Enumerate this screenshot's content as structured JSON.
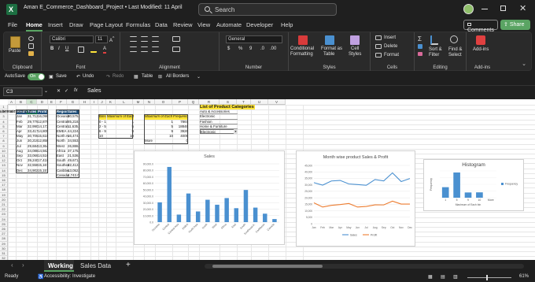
{
  "titlebar": {
    "file_title": "Aman E_Commerce_Dashboard_Project  •  Last Modified: 11 April",
    "search_placeholder": "Search"
  },
  "menu": {
    "tabs": [
      "File",
      "Home",
      "Insert",
      "Draw",
      "Page Layout",
      "Formulas",
      "Data",
      "Review",
      "View",
      "Automate",
      "Developer",
      "Help"
    ],
    "active": "Home",
    "comments_label": "Comments",
    "share_label": "Share"
  },
  "ribbon": {
    "paste": "Paste",
    "clipboard": "Clipboard",
    "font_name": "Calibri",
    "font_size": "11",
    "font": "Font",
    "alignment": "Alignment",
    "number_format": "General",
    "number": "Number",
    "conditional": "Conditional",
    "formatting": "Formatting",
    "format_as": "Format as",
    "table": "Table",
    "cell": "Cell",
    "styles_lbl": "Styles",
    "styles": "Styles",
    "insert": "Insert",
    "delete": "Delete",
    "format": "Format",
    "cells": "Cells",
    "sort_filter": "Sort &",
    "filter": "Filter",
    "find_select": "Find &",
    "select": "Select",
    "editing": "Editing",
    "addins": "Add-ins",
    "addins_group": "Add-ins"
  },
  "qat": {
    "autosave": "AutoSave",
    "toggle": "On",
    "save": "Save",
    "undo": "Undo",
    "redo": "Redo",
    "table": "Table",
    "all_borders": "All Borders"
  },
  "formula": {
    "name_box": "C3",
    "fx": "fx",
    "content": "Sales"
  },
  "columns": [
    "A",
    "B",
    "C",
    "D",
    "E",
    "F",
    "G",
    "H",
    "I",
    "J",
    "K",
    "L",
    "M",
    "N",
    "O",
    "P",
    "Q",
    "R",
    "S",
    "T",
    "U",
    "V"
  ],
  "rows": [
    "1",
    "2",
    "3",
    "4",
    "5",
    "6",
    "7",
    "8",
    "9",
    "10",
    "11",
    "12",
    "13",
    "14",
    "15",
    "16",
    "17",
    "18",
    "19",
    "20",
    "21",
    "22",
    "23",
    "24",
    "25",
    "26",
    "27",
    "28",
    "29",
    "30",
    "31",
    "32"
  ],
  "months_table": {
    "headers": [
      "Months",
      "Sales",
      "Profit"
    ],
    "rows": [
      [
        "Jan",
        "31,712",
        "16,090"
      ],
      [
        "Feb",
        "29,779",
        "12,879"
      ],
      [
        "Mar",
        "32,990",
        "14,173"
      ],
      [
        "Apr",
        "33,417",
        "14,805"
      ],
      [
        "May",
        "30,705",
        "15,618"
      ],
      [
        "Jun",
        "30,219",
        "12,858"
      ],
      [
        "Jul",
        "29,684",
        "13,364"
      ],
      [
        "Aug",
        "34,088",
        "14,562"
      ],
      [
        "Sep",
        "33,069",
        "14,516"
      ],
      [
        "Oct",
        "39,240",
        "17,418"
      ],
      [
        "Nov",
        "32,558",
        "15,167"
      ],
      [
        "Dec",
        "34,902",
        "15,157"
      ]
    ]
  },
  "regions_table": {
    "headers": [
      "Regions",
      "Sales"
    ],
    "rows": [
      [
        "Oceania",
        "30,575.8"
      ],
      [
        "Central",
        "85,218.0"
      ],
      [
        "Central Asia",
        "11,635.8"
      ],
      [
        "EMEA",
        "44,224.8"
      ],
      [
        "North Asia",
        "16,474.0"
      ],
      [
        "North",
        "34,553.0"
      ],
      [
        "West",
        "26,886.0"
      ],
      [
        "Africa",
        "37,175.0"
      ],
      [
        "East",
        "21,536.0"
      ],
      [
        "South",
        "49,671.0"
      ],
      [
        "Southeast A...",
        "22,412.0"
      ],
      [
        "Caribbean",
        "13,052.0"
      ],
      [
        "Canada",
        "4,743.0"
      ]
    ]
  },
  "bins_table": {
    "headers": [
      "Bins",
      "Maximum of Each bin"
    ],
    "rows": [
      [
        "0 - 1",
        "1"
      ],
      [
        "2 - 5",
        "5"
      ],
      [
        "6 - 9",
        "9"
      ],
      [
        "10",
        "10"
      ]
    ]
  },
  "freq_table": {
    "headers": [
      "Maximum of Each bin",
      "Frequency"
    ],
    "rows": [
      [
        "1",
        "7867"
      ],
      [
        "5",
        "18846"
      ],
      [
        "9",
        "3926"
      ],
      [
        "10",
        "4009"
      ],
      [
        "More",
        "0"
      ]
    ]
  },
  "categories": {
    "title": "List of Product Categories",
    "items": [
      "Auto & Accessories",
      "Electronic",
      "Fashion",
      "Home & Furniture"
    ],
    "electronic_label": "Electronic",
    "formula_text": "=OFFSET(D1:F11,2)",
    "dropdown": "Electronic"
  },
  "chart_sales": {
    "title": "Sales",
    "type": "bar",
    "categories": [
      "Oceania",
      "Central",
      "Central Asia",
      "EMEA",
      "North Asia",
      "North",
      "West",
      "Africa",
      "East",
      "South",
      "Southeast A.",
      "Caribbean",
      "Canada"
    ],
    "values": [
      30575.8,
      85218,
      11635.8,
      44224.8,
      16474,
      34553,
      26886,
      37175,
      21536,
      49671,
      22412,
      13052,
      4743
    ],
    "ylim": [
      0,
      90000
    ],
    "yticks": [
      "90,000.0",
      "80,000.0",
      "70,000.0",
      "60,000.0",
      "50,000.0",
      "40,000.0",
      "30,000.0",
      "20,000.0",
      "10,000.0",
      "0.0"
    ],
    "color": "#4a90d0"
  },
  "chart_line": {
    "title": "Month wise product Sales & Profit",
    "type": "line",
    "categories": [
      "Jan",
      "Feb",
      "Mar",
      "Apr",
      "May",
      "Jun",
      "Jul",
      "Aug",
      "Sep",
      "Oct",
      "Nov",
      "Dec"
    ],
    "series": [
      {
        "name": "Sales",
        "values": [
          31712,
          29779,
          32990,
          33417,
          30705,
          30219,
          29684,
          34088,
          33069,
          39240,
          32558,
          34902
        ],
        "color": "#4a90d0"
      },
      {
        "name": "Profit",
        "values": [
          16090,
          12879,
          14173,
          14805,
          15618,
          12858,
          13364,
          14562,
          14516,
          17418,
          15167,
          15157
        ],
        "color": "#ed7d31"
      }
    ],
    "ylim": [
      0,
      45000
    ],
    "yticks": [
      "45,000",
      "40,000",
      "35,000",
      "30,000",
      "25,000",
      "20,000",
      "15,000",
      "10,000",
      "5,000",
      "0"
    ]
  },
  "chart_hist": {
    "title": "Histogram",
    "type": "bar",
    "categories": [
      "1",
      "5",
      "9",
      "10",
      "More"
    ],
    "values": [
      7867,
      18846,
      3926,
      4009,
      0
    ],
    "ylim": [
      0,
      20000
    ],
    "ylabel": "Frequency",
    "xlabel": "Maximum of Each bin",
    "legend": "Frequency",
    "color": "#4a90d0"
  },
  "sheets": [
    "Working",
    "Sales Data"
  ],
  "active_sheet": "Working",
  "status": {
    "ready": "Ready",
    "accessibility": "Accessibility: Investigate",
    "zoom": "61%"
  }
}
